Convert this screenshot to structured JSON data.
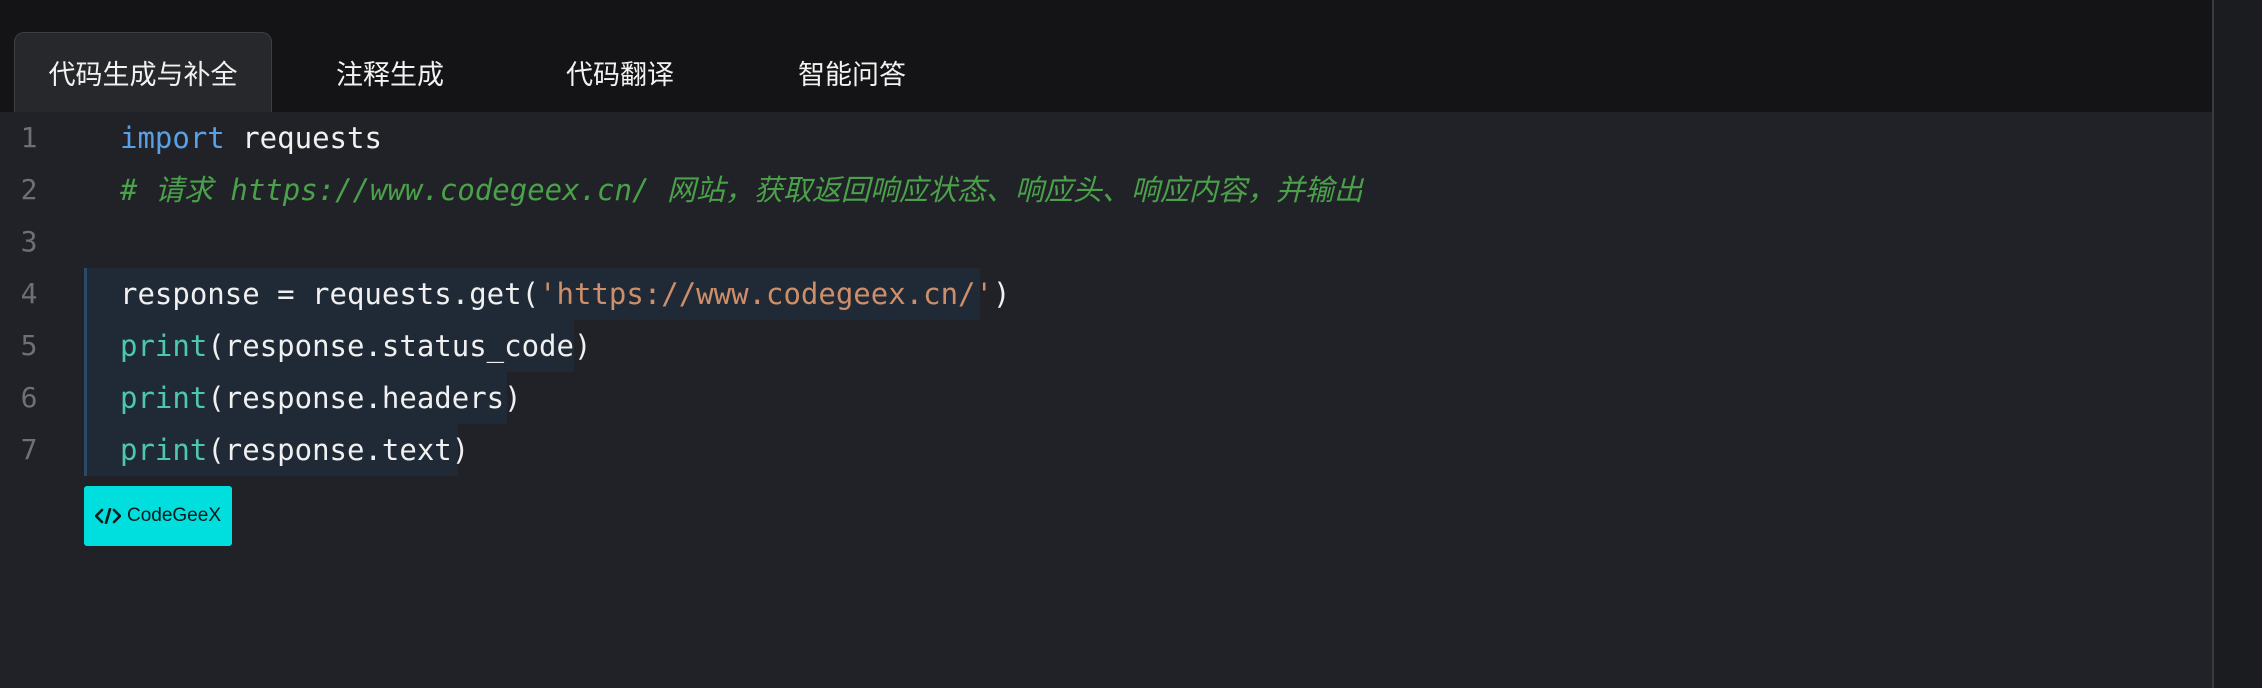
{
  "tabs": [
    {
      "label": "代码生成与补全",
      "active": true
    },
    {
      "label": "注释生成",
      "active": false
    },
    {
      "label": "代码翻译",
      "active": false
    },
    {
      "label": "智能问答",
      "active": false
    }
  ],
  "editor": {
    "line_numbers": [
      "1",
      "2",
      "3",
      "4",
      "5",
      "6",
      "7"
    ],
    "line1": {
      "keyword": "import",
      "rest": " requests"
    },
    "line2": {
      "comment": "# 请求 https://www.codegeex.cn/ 网站，获取返回响应状态、响应头、响应内容，并输出"
    },
    "line4": {
      "a": "response = requests.get(",
      "s": "'https://www.codegeex.cn/'",
      "b": ")"
    },
    "line5": {
      "fn": "print",
      "rest": "(response.status_code)"
    },
    "line6": {
      "fn": "print",
      "rest": "(response.headers)"
    },
    "line7": {
      "fn": "print",
      "rest": "(response.text)"
    }
  },
  "brand": {
    "label": "CodeGeeX",
    "color": "#00dede"
  },
  "colors": {
    "keyword": "#5aa0e6",
    "comment": "#4aa14a",
    "function": "#4ec7b0",
    "string": "#ce8e6a"
  }
}
